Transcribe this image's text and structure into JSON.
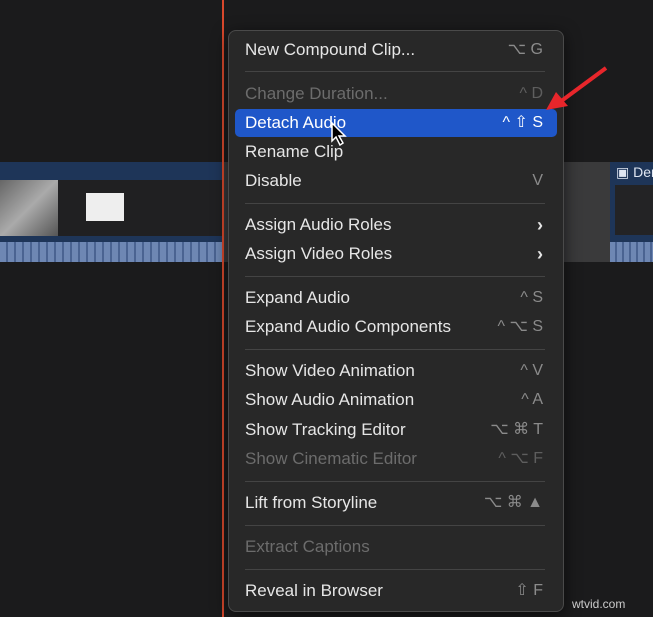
{
  "timeline": {
    "clip2_title": "Den"
  },
  "menu": {
    "items": [
      {
        "label": "New Compound Clip...",
        "shortcut": "⌥ G",
        "state": "normal"
      },
      {
        "label": "Change Duration...",
        "shortcut": "^ D",
        "state": "disabled"
      },
      {
        "label": "Detach Audio",
        "shortcut": "^ ⇧ S",
        "state": "highlighted"
      },
      {
        "label": "Rename Clip",
        "shortcut": "",
        "state": "normal"
      },
      {
        "label": "Disable",
        "shortcut": "V",
        "state": "normal"
      },
      {
        "label": "Assign Audio Roles",
        "shortcut": "›",
        "state": "submenu"
      },
      {
        "label": "Assign Video Roles",
        "shortcut": "›",
        "state": "submenu"
      },
      {
        "label": "Expand Audio",
        "shortcut": "^ S",
        "state": "normal"
      },
      {
        "label": "Expand Audio Components",
        "shortcut": "^ ⌥ S",
        "state": "normal"
      },
      {
        "label": "Show Video Animation",
        "shortcut": "^ V",
        "state": "normal"
      },
      {
        "label": "Show Audio Animation",
        "shortcut": "^ A",
        "state": "normal"
      },
      {
        "label": "Show Tracking Editor",
        "shortcut": "⌥ ⌘ T",
        "state": "normal"
      },
      {
        "label": "Show Cinematic Editor",
        "shortcut": "^ ⌥ F",
        "state": "disabled"
      },
      {
        "label": "Lift from Storyline",
        "shortcut": "⌥ ⌘ ▲",
        "state": "normal"
      },
      {
        "label": "Extract Captions",
        "shortcut": "",
        "state": "disabled"
      },
      {
        "label": "Reveal in Browser",
        "shortcut": "⇧ F",
        "state": "normal"
      }
    ]
  },
  "watermark": "wtvid.com",
  "colors": {
    "highlight": "#1f57c9",
    "playhead": "#d9482c",
    "arrow": "#e8262b"
  }
}
